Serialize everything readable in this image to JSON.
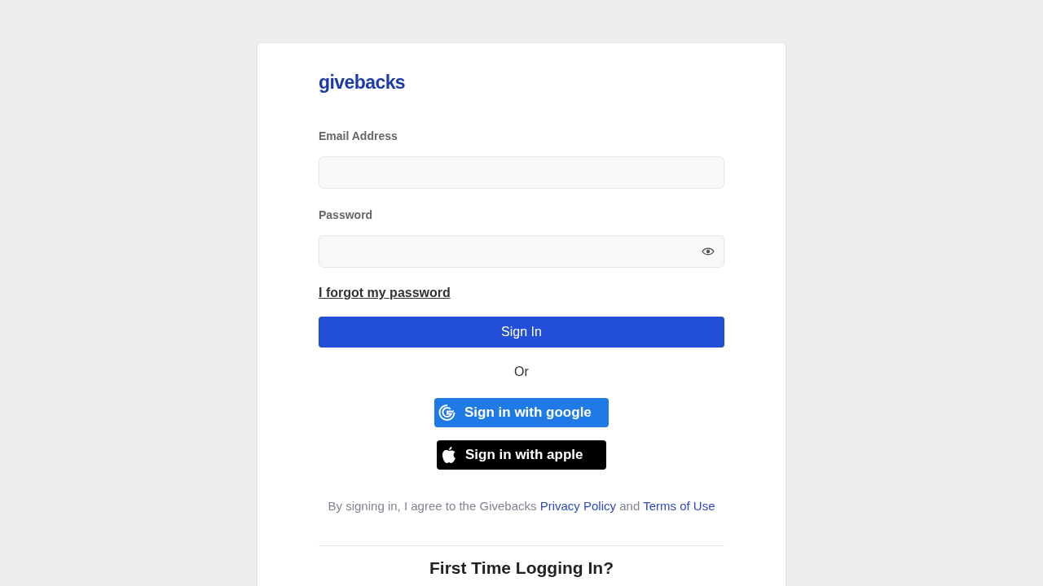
{
  "logo": "givebacks",
  "fields": [
    {
      "label": "Email Address",
      "kind": "text"
    },
    {
      "label": "Password",
      "kind": "password"
    }
  ],
  "forgot_link": "I forgot my password",
  "sign_in_button": "Sign In",
  "divider_text": "Or",
  "social_buttons": [
    {
      "kind": "google",
      "label": "Sign in with google"
    },
    {
      "kind": "apple",
      "label": "Sign in with apple"
    }
  ],
  "terms": {
    "text": "By signing in, I agree to the Givebacks",
    "privacy_link": "Privacy Policy",
    "joiner": "and",
    "terms_link": "Terms of Use"
  },
  "first_time_heading": "First Time Logging In?"
}
